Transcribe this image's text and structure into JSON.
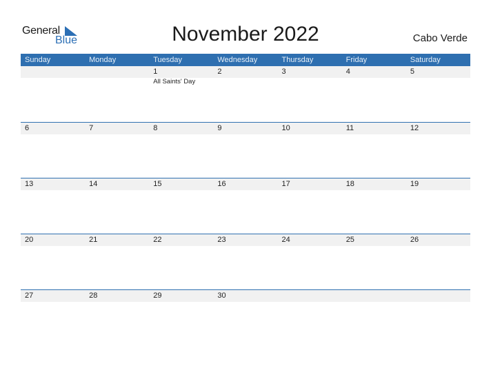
{
  "logo": {
    "line1": "General",
    "line2": "Blue"
  },
  "title": "November 2022",
  "country": "Cabo Verde",
  "colors": {
    "header_bg": "#2e6fb0",
    "date_strip": "#f1f1f1",
    "accent": "#2c6fb5"
  },
  "weekdays": [
    "Sunday",
    "Monday",
    "Tuesday",
    "Wednesday",
    "Thursday",
    "Friday",
    "Saturday"
  ],
  "weeks": [
    [
      {
        "day": "",
        "event": ""
      },
      {
        "day": "",
        "event": ""
      },
      {
        "day": "1",
        "event": "All Saints' Day"
      },
      {
        "day": "2",
        "event": ""
      },
      {
        "day": "3",
        "event": ""
      },
      {
        "day": "4",
        "event": ""
      },
      {
        "day": "5",
        "event": ""
      }
    ],
    [
      {
        "day": "6",
        "event": ""
      },
      {
        "day": "7",
        "event": ""
      },
      {
        "day": "8",
        "event": ""
      },
      {
        "day": "9",
        "event": ""
      },
      {
        "day": "10",
        "event": ""
      },
      {
        "day": "11",
        "event": ""
      },
      {
        "day": "12",
        "event": ""
      }
    ],
    [
      {
        "day": "13",
        "event": ""
      },
      {
        "day": "14",
        "event": ""
      },
      {
        "day": "15",
        "event": ""
      },
      {
        "day": "16",
        "event": ""
      },
      {
        "day": "17",
        "event": ""
      },
      {
        "day": "18",
        "event": ""
      },
      {
        "day": "19",
        "event": ""
      }
    ],
    [
      {
        "day": "20",
        "event": ""
      },
      {
        "day": "21",
        "event": ""
      },
      {
        "day": "22",
        "event": ""
      },
      {
        "day": "23",
        "event": ""
      },
      {
        "day": "24",
        "event": ""
      },
      {
        "day": "25",
        "event": ""
      },
      {
        "day": "26",
        "event": ""
      }
    ],
    [
      {
        "day": "27",
        "event": ""
      },
      {
        "day": "28",
        "event": ""
      },
      {
        "day": "29",
        "event": ""
      },
      {
        "day": "30",
        "event": ""
      },
      {
        "day": "",
        "event": ""
      },
      {
        "day": "",
        "event": ""
      },
      {
        "day": "",
        "event": ""
      }
    ]
  ]
}
